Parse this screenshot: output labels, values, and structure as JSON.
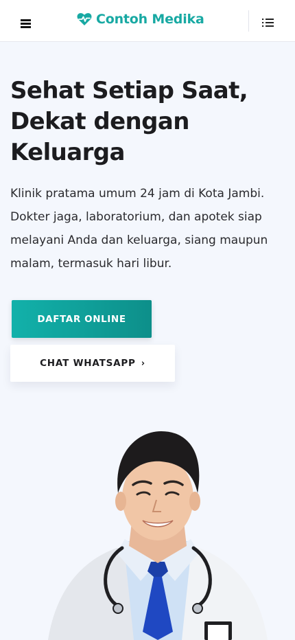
{
  "header": {
    "brand_name": "Contoh Medika",
    "menu_icon": "hamburger-menu-icon",
    "brand_icon": "heart-pulse-icon",
    "list_icon": "list-icon"
  },
  "hero": {
    "title": "Sehat Setiap Saat, Dekat dengan Keluarga",
    "description": "Klinik pratama umum 24 jam di Kota Jambi. Dokter jaga, laboratorium, dan apotek siap melayani Anda dan keluarga, siang maupun malam, termasuk hari libur.",
    "primary_button": "DAFTAR ONLINE",
    "secondary_button": "CHAT WHATSAPP",
    "secondary_icon": "chevron-right-icon",
    "image": "doctor-photo"
  },
  "colors": {
    "accent": "#18a9a3",
    "accent_dark": "#0d8f8a",
    "background": "#f4f7fd"
  }
}
